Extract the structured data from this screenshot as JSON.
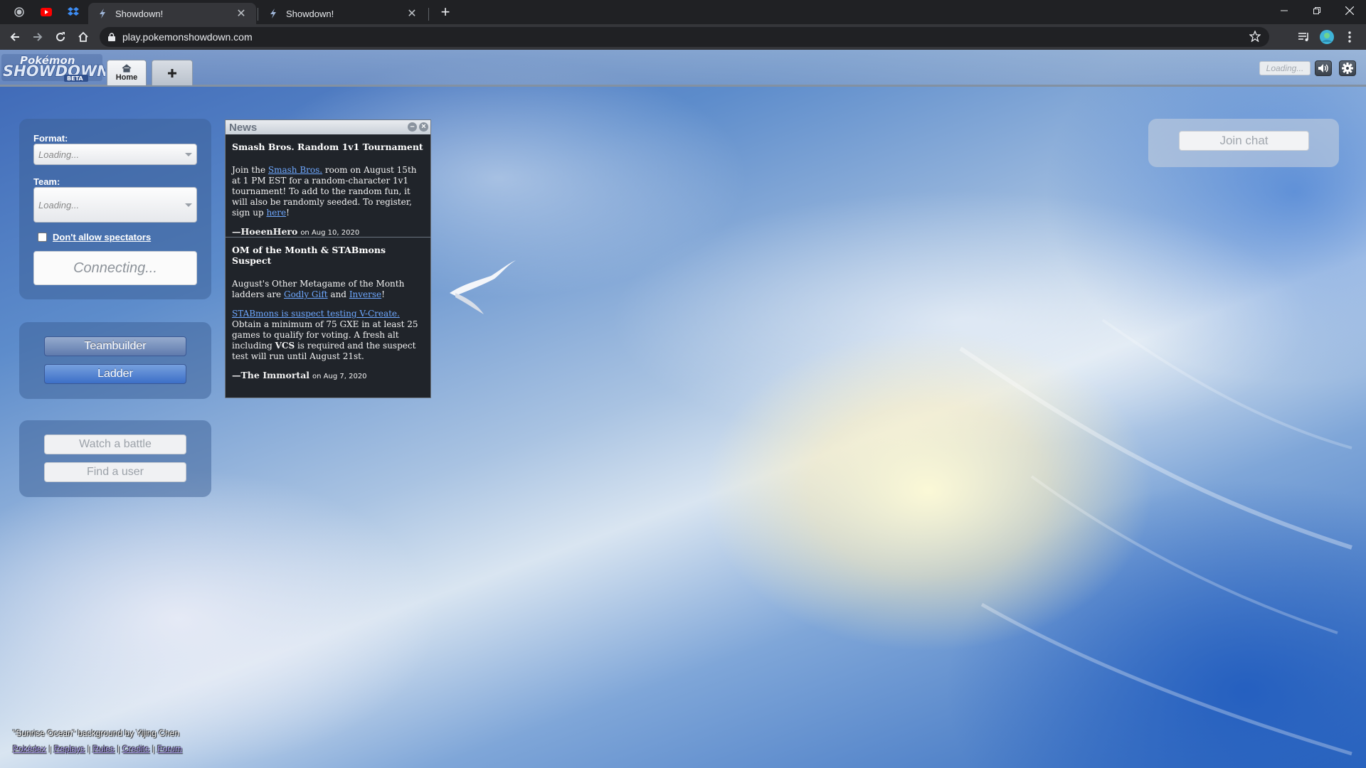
{
  "browser": {
    "tabs": [
      {
        "title": "Showdown!",
        "active": true
      },
      {
        "title": "Showdown!",
        "active": false
      }
    ],
    "url": "play.pokemonshowdown.com"
  },
  "header": {
    "logo_line1": "Pokémon",
    "logo_line2": "SHOWDOWN!",
    "logo_badge": "BETA",
    "home_tab": "Home",
    "loading_label": "Loading..."
  },
  "main_menu": {
    "format_label": "Format:",
    "format_value": "Loading...",
    "team_label": "Team:",
    "team_value": "Loading...",
    "spectators_label": "Don't allow spectators",
    "connecting_label": "Connecting...",
    "teambuilder_label": "Teambuilder",
    "ladder_label": "Ladder",
    "watch_label": "Watch a battle",
    "find_user_label": "Find a user"
  },
  "news": {
    "title": "News",
    "items": [
      {
        "heading": "Smash Bros. Random 1v1 Tournament",
        "p1_a": "Join the ",
        "p1_link": "Smash Bros.",
        "p1_b": " room on August 15th at 1 PM EST for a random-character 1v1 tournament! To add to the random fun, it will also be randomly seeded. To register, sign up ",
        "p1_link2": "here",
        "p1_c": "!",
        "author": "—HoeenHero",
        "date": "on Aug 10, 2020"
      },
      {
        "heading": "OM of the Month & STABmons Suspect",
        "p1_a": "August's Other Metagame of the Month ladders are ",
        "p1_link": "Godly Gift",
        "p1_b": " and ",
        "p1_link2": "Inverse",
        "p1_c": "!",
        "p2_link": "STABmons is suspect testing V-Create.",
        "p2_a": " Obtain a minimum of 75 GXE in at least 25 games to qualify for voting. A fresh alt including ",
        "p2_bold": "VCS",
        "p2_b": " is required and the suspect test will run until August 21st.",
        "author": "—The Immortal",
        "date": "on Aug 7, 2020"
      }
    ]
  },
  "chat": {
    "join_label": "Join chat"
  },
  "footer": {
    "credit": "\"Sunrise Ocean\" background by Yijing Chen",
    "links": [
      "Pokédex",
      "Replays",
      "Rules",
      "Credits",
      "Forum"
    ]
  },
  "colors": {
    "ladder_button": "#3c6fc7",
    "news_bg": "#20242a",
    "link": "#6ea8ff"
  }
}
